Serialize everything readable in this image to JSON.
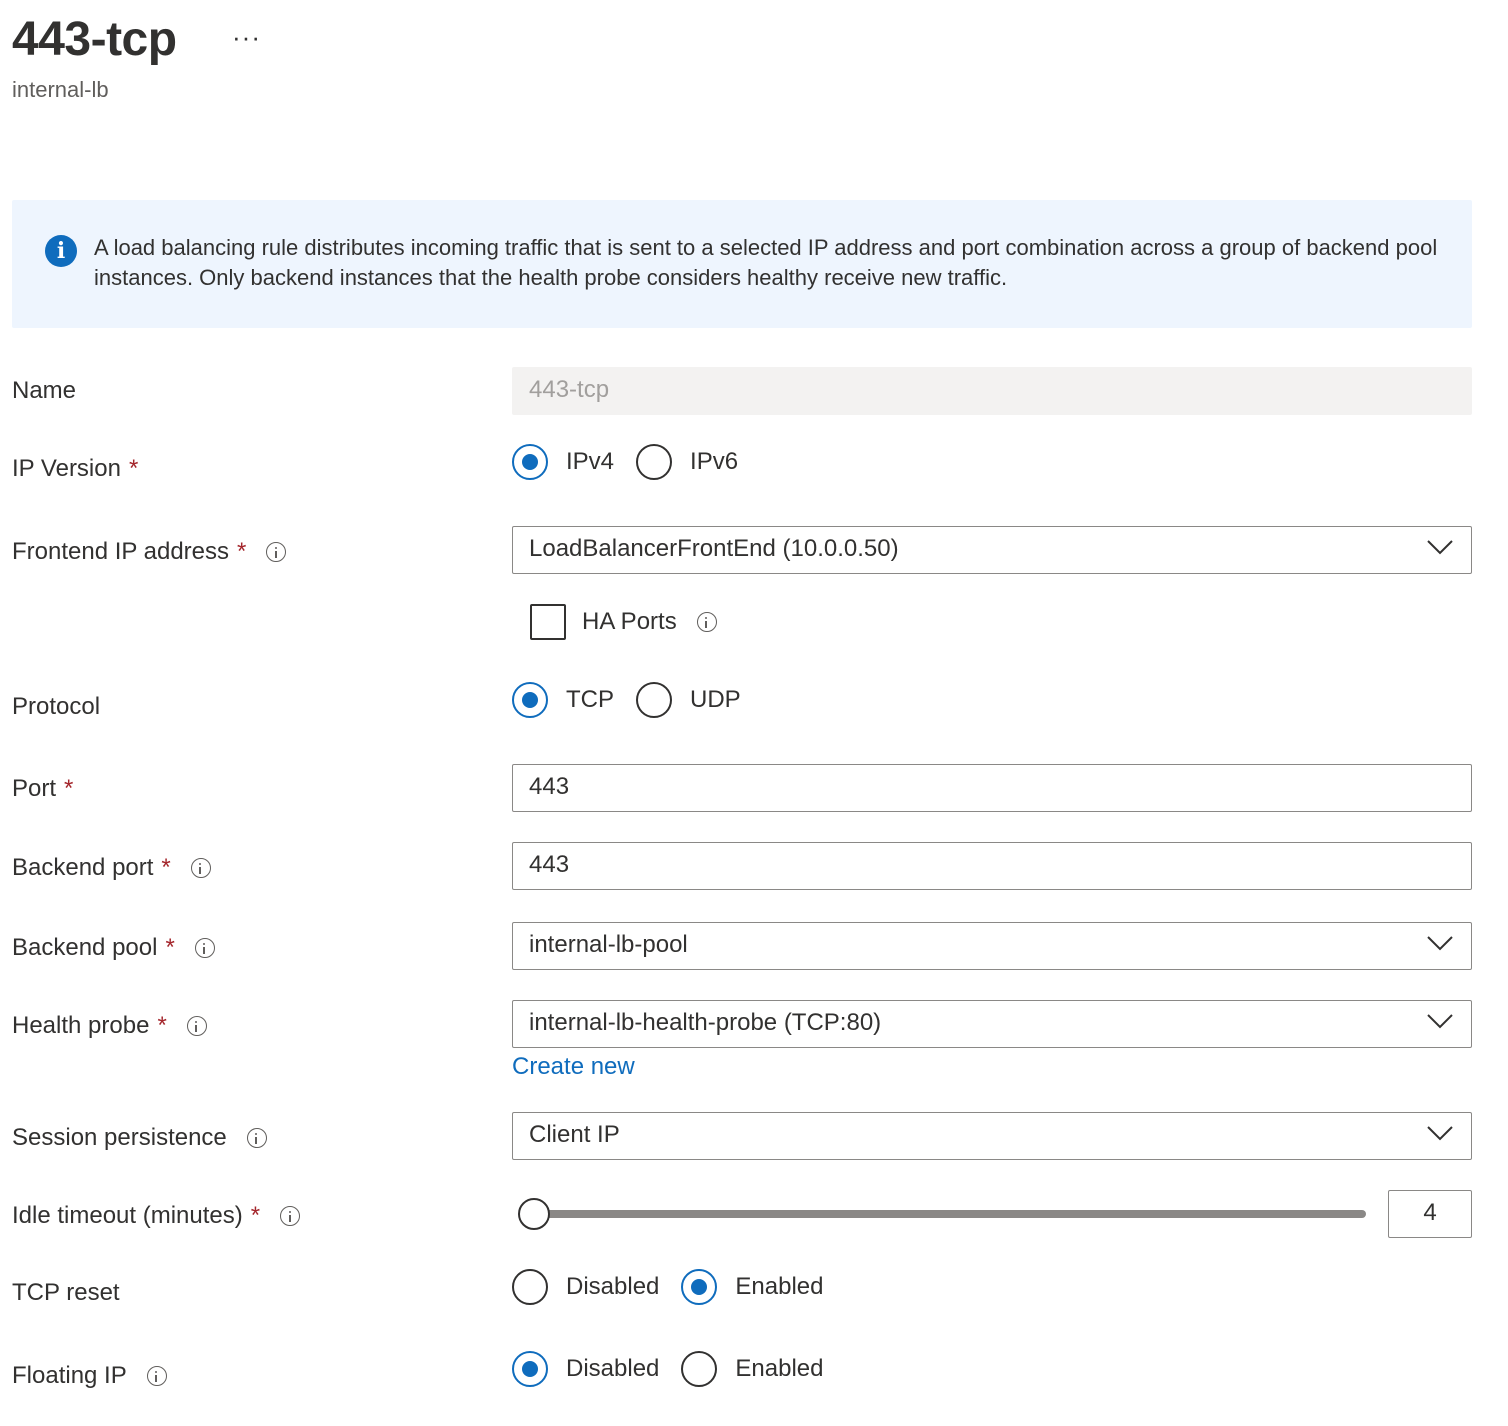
{
  "header": {
    "title": "443-tcp",
    "more_label": "···",
    "subtitle": "internal-lb"
  },
  "info": {
    "icon": "info-icon",
    "text": "A load balancing rule distributes incoming traffic that is sent to a selected IP address and port combination across a group of backend pool instances. Only backend instances that the health probe considers healthy receive new traffic."
  },
  "colors": {
    "accent": "#0f6cbd",
    "required": "#a4262c",
    "info_background": "#eef5fe"
  },
  "form": {
    "name": {
      "label": "Name",
      "value": "443-tcp",
      "disabled": true
    },
    "ip_version": {
      "label": "IP Version",
      "required_mark": "*",
      "options": [
        "IPv4",
        "IPv6"
      ],
      "selected": "IPv4"
    },
    "frontend_ip": {
      "label": "Frontend IP address",
      "required_mark": "*",
      "value": "LoadBalancerFrontEnd (10.0.0.50)"
    },
    "ha_ports": {
      "label": "HA Ports",
      "checked": false
    },
    "protocol": {
      "label": "Protocol",
      "options": [
        "TCP",
        "UDP"
      ],
      "selected": "TCP"
    },
    "port": {
      "label": "Port",
      "required_mark": "*",
      "value": "443"
    },
    "backend_port": {
      "label": "Backend port",
      "required_mark": "*",
      "value": "443"
    },
    "backend_pool": {
      "label": "Backend pool",
      "required_mark": "*",
      "value": "internal-lb-pool"
    },
    "health_probe": {
      "label": "Health probe",
      "required_mark": "*",
      "value": "internal-lb-health-probe (TCP:80)",
      "create_new_label": "Create new"
    },
    "session_persistence": {
      "label": "Session persistence",
      "value": "Client IP"
    },
    "idle_timeout": {
      "label": "Idle timeout (minutes)",
      "required_mark": "*",
      "value": "4",
      "slider_fraction": 0.0
    },
    "tcp_reset": {
      "label": "TCP reset",
      "options": [
        "Disabled",
        "Enabled"
      ],
      "selected": "Enabled"
    },
    "floating_ip": {
      "label": "Floating IP",
      "options": [
        "Disabled",
        "Enabled"
      ],
      "selected": "Disabled"
    }
  }
}
